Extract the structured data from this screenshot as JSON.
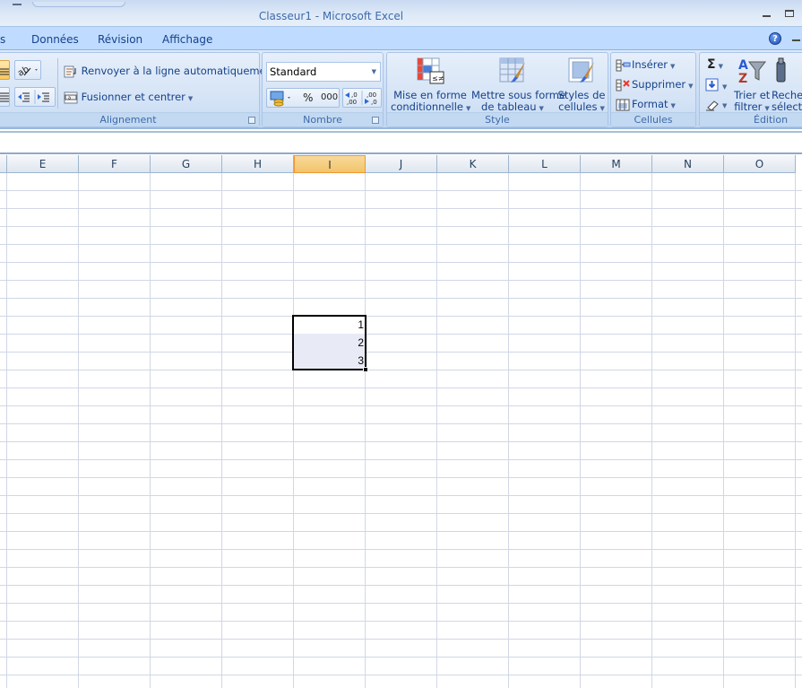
{
  "window": {
    "title": "Classeur1 - Microsoft Excel",
    "controls": [
      "minimize-icon",
      "restore-icon"
    ]
  },
  "tabs": [
    {
      "label": "s"
    },
    {
      "label": "Données"
    },
    {
      "label": "Révision"
    },
    {
      "label": "Affichage"
    }
  ],
  "help_label": "?",
  "ribbon": {
    "alignment": {
      "label": "Alignement",
      "wrap_text": "Renvoyer à la ligne automatiquement",
      "merge_center": "Fusionner et centrer"
    },
    "number": {
      "label": "Nombre",
      "format_value": "Standard",
      "percent": "%",
      "thousands": "000",
      "inc_decimal": "←,0 ,00",
      "dec_decimal": ",00 →,0"
    },
    "style": {
      "label": "Style",
      "conditional_line1": "Mise en forme",
      "conditional_line2": "conditionnelle",
      "table_line1": "Mettre sous forme",
      "table_line2": "de tableau",
      "cellstyles_line1": "Styles de",
      "cellstyles_line2": "cellules"
    },
    "cells": {
      "label": "Cellules",
      "insert": "Insérer",
      "delete": "Supprimer",
      "format": "Format"
    },
    "editing": {
      "label": "Édition",
      "sum": "Σ",
      "sort_line1": "Trier et",
      "sort_line2": "filtrer",
      "find_line1": "Recher",
      "find_line2": "sélectio"
    }
  },
  "columns": [
    "E",
    "F",
    "G",
    "H",
    "I",
    "J",
    "K",
    "L",
    "M",
    "N",
    "O"
  ],
  "selected_column": "I",
  "cells": [
    {
      "col": "I",
      "value": "1"
    },
    {
      "col": "I",
      "value": "2"
    },
    {
      "col": "I",
      "value": "3"
    }
  ],
  "colors": {
    "selected_header": "#f1c46a",
    "selection_fill": "#e8ebf5",
    "ribbon_text": "#15428b"
  }
}
